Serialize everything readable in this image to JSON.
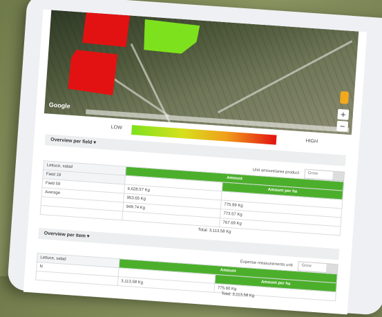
{
  "map": {
    "provider_logo": "Google",
    "zoom_in": "+",
    "zoom_out": "−"
  },
  "legend": {
    "low": "LOW",
    "high": "HIGH"
  },
  "per_field": {
    "title": "Overview per field",
    "filter_text": "Unit amount/area product",
    "toggle_label": "Grow",
    "header_left": "Lettuce, salad",
    "col1": "Amount",
    "col2": "Amount per ha",
    "rows": [
      {
        "name": "Field 19",
        "amount": "",
        "per_ha": ""
      },
      {
        "name": "Field 59",
        "amount": "6,628.57 Kg",
        "per_ha": ""
      },
      {
        "name": "Average",
        "amount": "953.65 Kg",
        "per_ha": "775.99 Kg"
      },
      {
        "name": "",
        "amount": "949.74 Kg",
        "per_ha": "773.57 Kg"
      }
    ],
    "extra": "767.69 Kg",
    "total": "Total: 3,113.58 Kg"
  },
  "per_item": {
    "title": "Overview per item",
    "filter_text": "Expense measurements unit",
    "toggle_label": "Grow",
    "header_left": "Lettuce, salad",
    "col1": "Amount",
    "col2": "Amount per ha",
    "rows": [
      {
        "name": "N",
        "amount": "",
        "per_ha": ""
      },
      {
        "name": "",
        "amount": "3,113.58 Kg",
        "per_ha": "775.60 Kg"
      }
    ],
    "total": "Total: 3,113.58 Kg"
  }
}
